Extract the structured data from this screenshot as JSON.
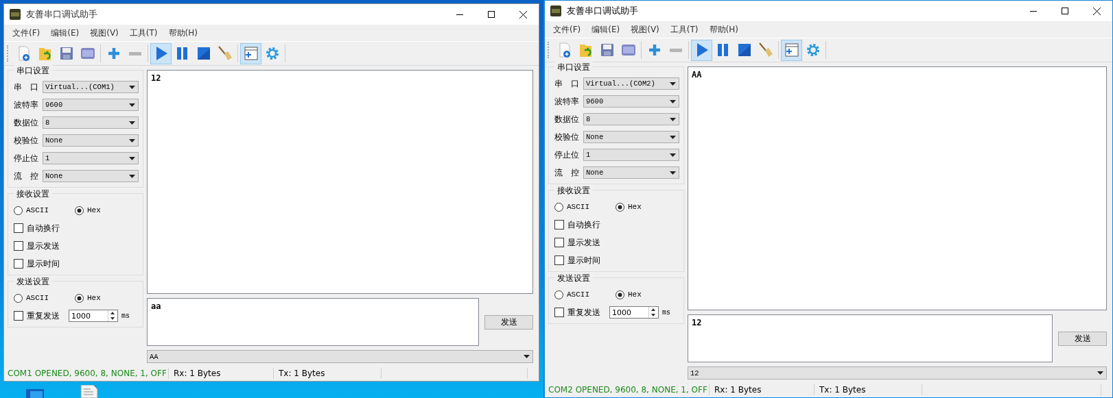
{
  "windows": [
    {
      "title": "友善串口调试助手",
      "focused": false,
      "menu": [
        "文件(F)",
        "编辑(E)",
        "视图(V)",
        "工具(T)",
        "帮助(H)"
      ],
      "toolbar": [
        {
          "buttons": [
            {
              "kind": "new",
              "selected": false
            },
            {
              "kind": "open",
              "selected": false
            },
            {
              "kind": "save",
              "selected": false
            },
            {
              "kind": "log",
              "selected": false
            }
          ]
        },
        {
          "buttons": [
            {
              "kind": "add",
              "selected": false
            },
            {
              "kind": "remove",
              "selected": false
            }
          ]
        },
        {
          "buttons": [
            {
              "kind": "play",
              "selected": true
            },
            {
              "kind": "pause",
              "selected": false
            },
            {
              "kind": "stop",
              "selected": false
            },
            {
              "kind": "clear",
              "selected": false
            }
          ]
        },
        {
          "buttons": [
            {
              "kind": "window",
              "selected": true
            },
            {
              "kind": "settings",
              "selected": false
            }
          ]
        }
      ],
      "serial_settings": {
        "title": "串口设置",
        "fields": [
          {
            "label": "串　口",
            "value": "Virtual...(COM1)"
          },
          {
            "label": "波特率",
            "value": "9600"
          },
          {
            "label": "数据位",
            "value": "8"
          },
          {
            "label": "校验位",
            "value": "None"
          },
          {
            "label": "停止位",
            "value": "1"
          },
          {
            "label": "流　控",
            "value": "None"
          }
        ]
      },
      "receive_settings": {
        "title": "接收设置",
        "modes": [
          {
            "label": "ASCII",
            "selected": false
          },
          {
            "label": "Hex",
            "selected": true
          }
        ],
        "options": [
          {
            "label": "自动换行",
            "checked": false
          },
          {
            "label": "显示发送",
            "checked": false
          },
          {
            "label": "显示时间",
            "checked": false
          }
        ]
      },
      "send_settings": {
        "title": "发送设置",
        "modes": [
          {
            "label": "ASCII",
            "selected": false
          },
          {
            "label": "Hex",
            "selected": true
          }
        ],
        "repeat": {
          "label": "重复发送",
          "checked": false,
          "value": "1000",
          "unit": "ms"
        }
      },
      "receive_text": "12",
      "send_text": "aa",
      "send_button": "发送",
      "history": "AA",
      "status": {
        "connection": "COM1 OPENED, 9600, 8, NONE, 1, OFF",
        "rx": "Rx: 1 Bytes",
        "tx": "Tx: 1 Bytes"
      }
    },
    {
      "title": "友善串口调试助手",
      "focused": true,
      "menu": [
        "文件(F)",
        "编辑(E)",
        "视图(V)",
        "工具(T)",
        "帮助(H)"
      ],
      "toolbar": [
        {
          "buttons": [
            {
              "kind": "new",
              "selected": false
            },
            {
              "kind": "open",
              "selected": false
            },
            {
              "kind": "save",
              "selected": false
            },
            {
              "kind": "log",
              "selected": false
            }
          ]
        },
        {
          "buttons": [
            {
              "kind": "add",
              "selected": false
            },
            {
              "kind": "remove",
              "selected": false
            }
          ]
        },
        {
          "buttons": [
            {
              "kind": "play",
              "selected": true
            },
            {
              "kind": "pause",
              "selected": false
            },
            {
              "kind": "stop",
              "selected": false
            },
            {
              "kind": "clear",
              "selected": false
            }
          ]
        },
        {
          "buttons": [
            {
              "kind": "window",
              "selected": true
            },
            {
              "kind": "settings",
              "selected": false
            }
          ]
        }
      ],
      "serial_settings": {
        "title": "串口设置",
        "fields": [
          {
            "label": "串　口",
            "value": "Virtual...(COM2)"
          },
          {
            "label": "波特率",
            "value": "9600"
          },
          {
            "label": "数据位",
            "value": "8"
          },
          {
            "label": "校验位",
            "value": "None"
          },
          {
            "label": "停止位",
            "value": "1"
          },
          {
            "label": "流　控",
            "value": "None"
          }
        ]
      },
      "receive_settings": {
        "title": "接收设置",
        "modes": [
          {
            "label": "ASCII",
            "selected": false
          },
          {
            "label": "Hex",
            "selected": true
          }
        ],
        "options": [
          {
            "label": "自动换行",
            "checked": false
          },
          {
            "label": "显示发送",
            "checked": false
          },
          {
            "label": "显示时间",
            "checked": false
          }
        ]
      },
      "send_settings": {
        "title": "发送设置",
        "modes": [
          {
            "label": "ASCII",
            "selected": false
          },
          {
            "label": "Hex",
            "selected": true
          }
        ],
        "repeat": {
          "label": "重复发送",
          "checked": false,
          "value": "1000",
          "unit": "ms"
        }
      },
      "receive_text": "AA",
      "send_text": "12",
      "send_button": "发送",
      "history": "12",
      "status": {
        "connection": "COM2 OPENED, 9600, 8, NONE, 1, OFF",
        "rx": "Rx: 1 Bytes",
        "tx": "Tx: 1 Bytes"
      }
    }
  ]
}
